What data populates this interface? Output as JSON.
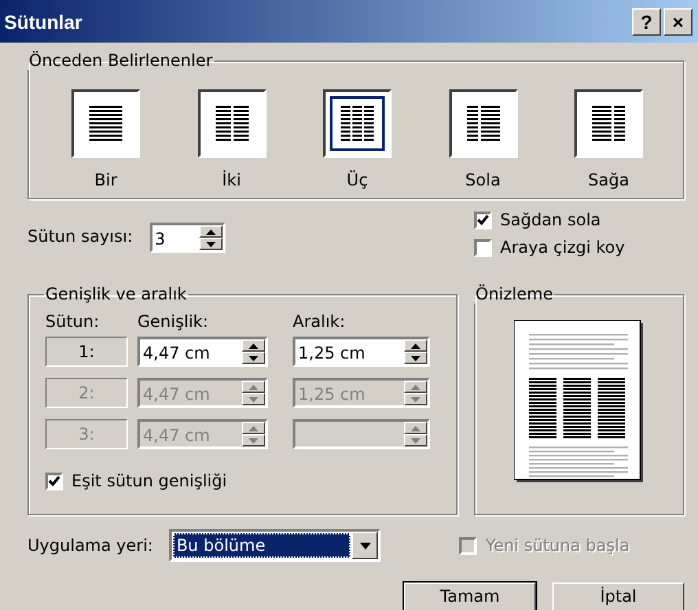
{
  "window": {
    "title": "Sütunlar",
    "help_button": "?",
    "close_button": "×"
  },
  "presets": {
    "title": "Önceden Belirlenenler",
    "items": [
      {
        "label": "Bir",
        "kind": "one",
        "selected": false
      },
      {
        "label": "İki",
        "kind": "two",
        "selected": false
      },
      {
        "label": "Üç",
        "kind": "three",
        "selected": true
      },
      {
        "label": "Sola",
        "kind": "left",
        "selected": false
      },
      {
        "label": "Sağa",
        "kind": "right",
        "selected": false
      }
    ]
  },
  "column_count": {
    "label": "Sütun sayısı:",
    "value": "3"
  },
  "options": [
    {
      "label": "Sağdan sola",
      "checked": true
    },
    {
      "label": "Araya çizgi koy",
      "checked": false
    }
  ],
  "width_spacing": {
    "title": "Genişlik ve aralık",
    "headers": [
      "Sütun:",
      "Genişlik:",
      "Aralık:"
    ],
    "rows": [
      {
        "number": "1:",
        "width": "4,47 cm",
        "spacing": "1,25 cm",
        "disabled": false
      },
      {
        "number": "2:",
        "width": "4,47 cm",
        "spacing": "1,25 cm",
        "disabled": true
      },
      {
        "number": "3:",
        "width": "4,47 cm",
        "disabled": true
      }
    ],
    "equal_width": {
      "label": "Eşit sütun genişliği",
      "checked": true
    }
  },
  "preview": {
    "title": "Önizleme"
  },
  "apply_to": {
    "label": "Uygulama yeri:",
    "value": "Bu bölüme"
  },
  "new_column": {
    "label": "Yeni sütuna başla",
    "checked": false,
    "disabled": true
  },
  "buttons": [
    "Tamam",
    "İptal"
  ]
}
